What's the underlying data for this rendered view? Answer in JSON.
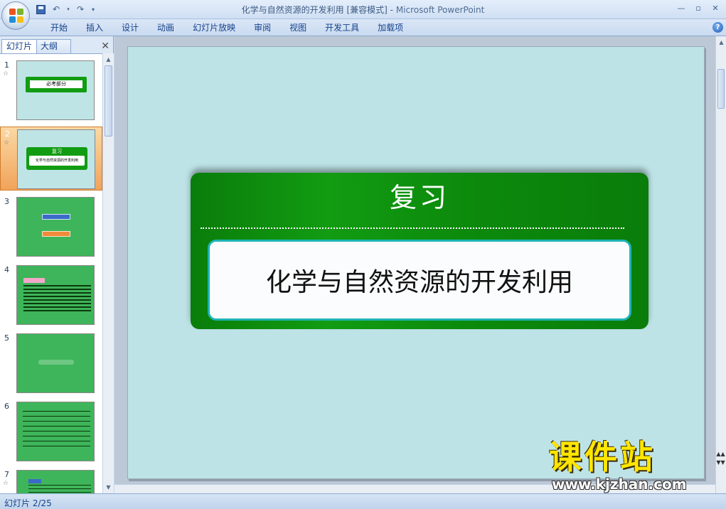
{
  "window": {
    "title": "化学与自然资源的开发利用 [兼容模式]",
    "app_name": "Microsoft PowerPoint",
    "separator": " - "
  },
  "ribbon": {
    "tabs": [
      "开始",
      "插入",
      "设计",
      "动画",
      "幻灯片放映",
      "审阅",
      "视图",
      "开发工具",
      "加载项"
    ]
  },
  "left_pane": {
    "tab_slides": "幻灯片",
    "tab_outline": "大纲",
    "thumbnails": [
      {
        "num": "1",
        "star": true,
        "text": "必考部分"
      },
      {
        "num": "2",
        "star": true,
        "text": "复习",
        "selected": true
      },
      {
        "num": "3",
        "star": false,
        "text": ""
      },
      {
        "num": "4",
        "star": false,
        "text": ""
      },
      {
        "num": "5",
        "star": false,
        "text": ""
      },
      {
        "num": "6",
        "star": false,
        "text": ""
      },
      {
        "num": "7",
        "star": true,
        "text": ""
      }
    ]
  },
  "slide": {
    "title": "复习",
    "subtitle": "化学与自然资源的开发利用"
  },
  "status": {
    "slide_indicator": "幻灯片 2/25"
  },
  "watermark": {
    "brand": "课件站",
    "url": "www.kjzhan.com"
  },
  "colors": {
    "slide_bg": "#bde3e7",
    "banner_green": "#0f8f0f",
    "box_border": "#1fb4b4"
  }
}
